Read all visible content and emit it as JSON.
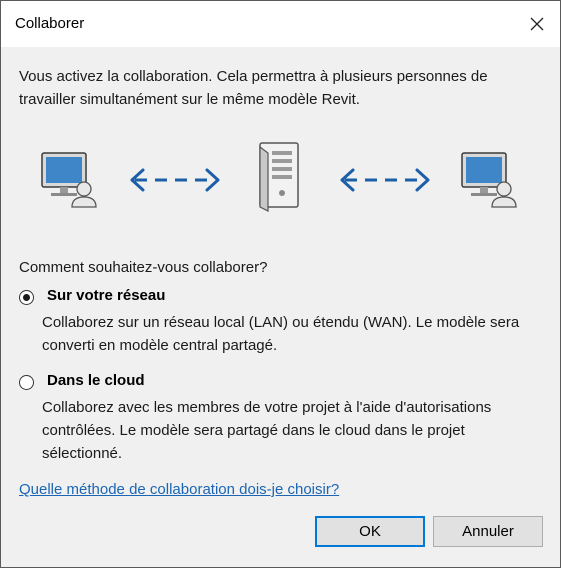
{
  "window": {
    "title": "Collaborer"
  },
  "intro_text": "Vous activez la collaboration. Cela permettra à plusieurs personnes de travailler simultanément sur le même modèle Revit.",
  "question": "Comment souhaitez-vous collaborer?",
  "options": [
    {
      "label": "Sur votre réseau",
      "description": "Collaborez sur un réseau local (LAN) ou étendu (WAN). Le modèle sera converti en modèle central partagé.",
      "selected": true
    },
    {
      "label": "Dans le cloud",
      "description": "Collaborez avec les membres de votre projet à l'aide d'autorisations contrôlées. Le modèle sera partagé dans le cloud dans le projet sélectionné.",
      "selected": false
    }
  ],
  "help_link": "Quelle méthode de collaboration dois-je choisir?",
  "buttons": {
    "ok": "OK",
    "cancel": "Annuler"
  },
  "colors": {
    "accent": "#0078d7",
    "arrow": "#1c5ea8",
    "link": "#1a66b4"
  },
  "illustration": {
    "icons": [
      "computer-user-icon",
      "double-arrow-icon",
      "server-icon",
      "double-arrow-icon",
      "computer-user-icon"
    ]
  }
}
